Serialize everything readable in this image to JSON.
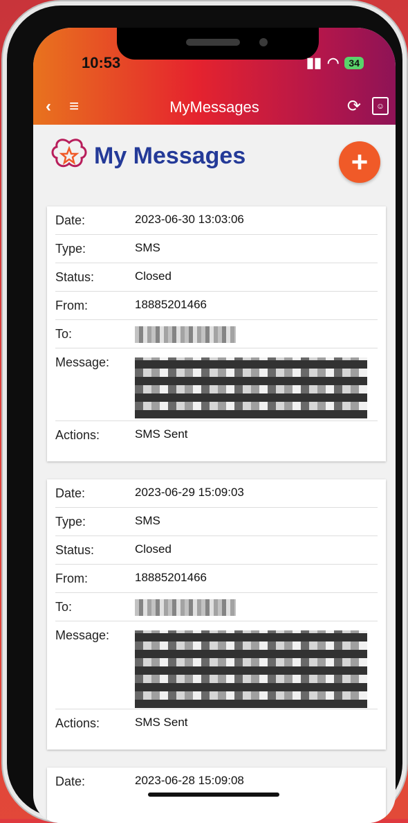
{
  "status_bar": {
    "time": "10:53",
    "battery": "34"
  },
  "app_bar": {
    "title": "MyMessages"
  },
  "page": {
    "title": "My Messages",
    "add_label": "+"
  },
  "labels": {
    "date": "Date:",
    "type": "Type:",
    "status": "Status:",
    "from": "From:",
    "to": "To:",
    "message": "Message:",
    "actions": "Actions:"
  },
  "messages": [
    {
      "date": "2023-06-30 13:03:06",
      "type": "SMS",
      "status": "Closed",
      "from": "18885201466",
      "actions": "SMS Sent"
    },
    {
      "date": "2023-06-29 15:09:03",
      "type": "SMS",
      "status": "Closed",
      "from": "18885201466",
      "actions": "SMS Sent"
    },
    {
      "date": "2023-06-28 15:09:08"
    }
  ],
  "icons": {
    "back": "chevron-left-icon",
    "menu": "hamburger-icon",
    "refresh": "refresh-icon",
    "contacts": "contacts-icon",
    "add": "plus-icon"
  }
}
